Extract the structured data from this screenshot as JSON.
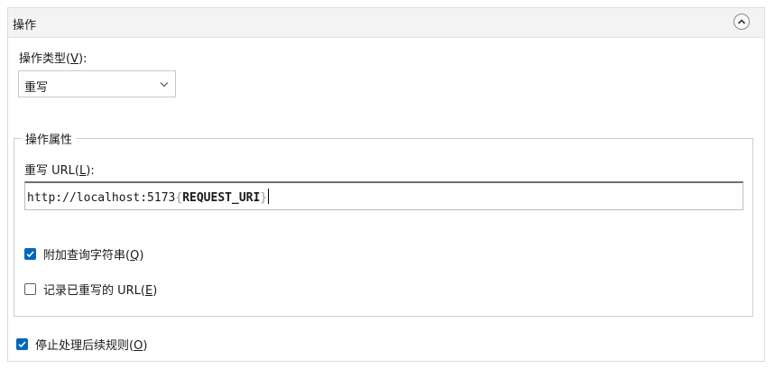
{
  "panel": {
    "title": "操作",
    "collapse_icon": "chevron-up-icon"
  },
  "action_type": {
    "label_prefix": "操作类型(",
    "label_hotkey": "V",
    "label_suffix": "):",
    "selected": "重写"
  },
  "action_properties": {
    "legend": "操作属性",
    "rewrite_url_label_prefix": "重写 URL(",
    "rewrite_url_label_hotkey": "L",
    "rewrite_url_label_suffix": "):",
    "url_prefix": "http://localhost:5173",
    "url_brace_open": "{",
    "url_variable": "REQUEST_URI",
    "url_brace_close": "}",
    "append_query": {
      "label_prefix": "附加查询字符串(",
      "label_hotkey": "Q",
      "label_suffix": ")",
      "checked": true
    },
    "log_rewritten": {
      "label_prefix": "记录已重写的 URL(",
      "label_hotkey": "E",
      "label_suffix": ")",
      "checked": false
    }
  },
  "stop_processing": {
    "label_prefix": "停止处理后续规则(",
    "label_hotkey": "O",
    "label_suffix": ")",
    "checked": true
  },
  "colors": {
    "accent": "#0067c0",
    "header_bg": "#f3f3f3",
    "border": "#dcdcdc"
  }
}
